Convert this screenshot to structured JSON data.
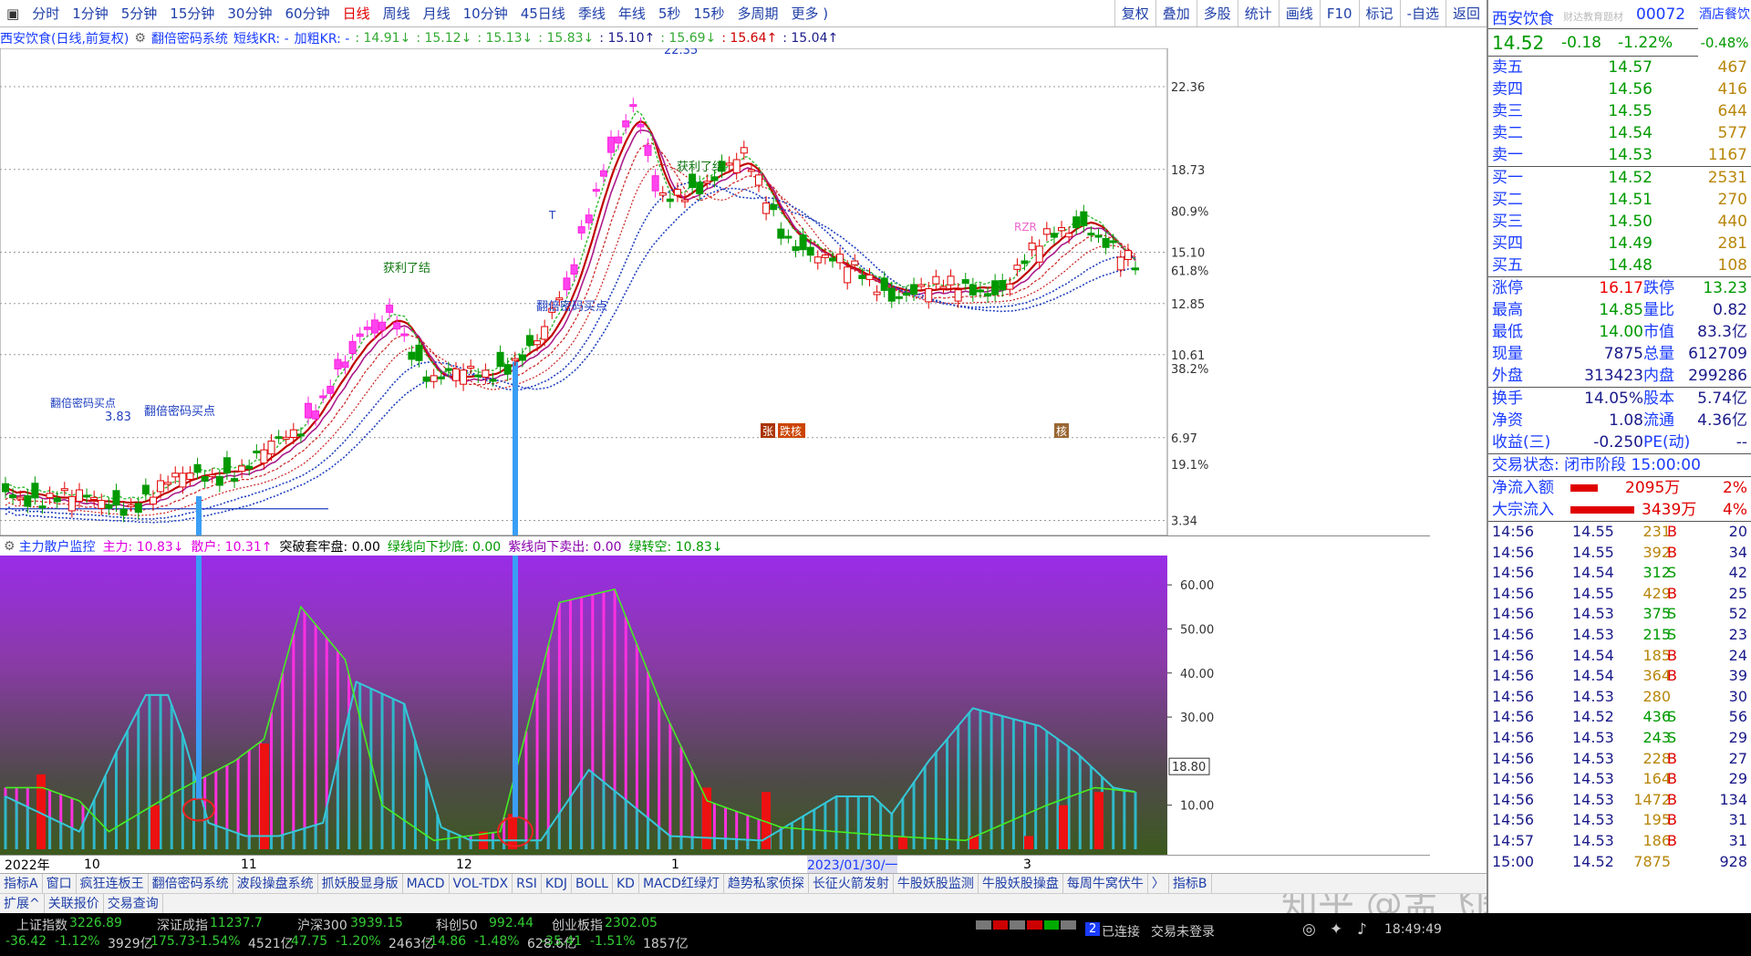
{
  "toolbar": {
    "periods": [
      "分时",
      "1分钟",
      "5分钟",
      "15分钟",
      "30分钟",
      "60分钟",
      "日线",
      "周线",
      "月线",
      "10分钟",
      "45日线",
      "季线",
      "年线",
      "5秒",
      "15秒",
      "多周期",
      "更多 )"
    ],
    "active_index": 6,
    "right": [
      "复权",
      "叠加",
      "多股",
      "统计",
      "画线",
      "F10",
      "标记",
      "-自选",
      "返回"
    ]
  },
  "chart_title": {
    "stock": "西安饮食(日线,前复权)",
    "system": "翻倍密码系统",
    "kr_label": "短线KR: -",
    "jc_label": "加粗KR: -",
    "values": [
      ": 14.91↓",
      ": 15.12↓",
      ": 15.13↓",
      ": 15.83↓",
      ": 15.10↑",
      ": 15.69↓",
      ": 15.64↑",
      ": 15.04↑"
    ]
  },
  "price_axis": {
    "labels": [
      "22.36",
      "18.73",
      "15.10",
      "12.85",
      "10.61",
      "6.97",
      "3.34"
    ],
    "pct": [
      "80.9%",
      "61.8%",
      "38.2%",
      "19.1%"
    ]
  },
  "annotations": {
    "peak": "22.35",
    "low": "3.83",
    "profit1": "获利了结",
    "profit2": "获利了结",
    "buy1": "翻倍密码买点",
    "buy2": "翻倍密码买点",
    "buy3": "翻倍密码买点",
    "rzr": "RZR",
    "t": "T",
    "zhang": "张",
    "dietan": "跌核",
    "tan": "核"
  },
  "sub_title": {
    "name": "主力散户监控",
    "items": [
      "主力: 10.83↓",
      "散户: 10.31↑",
      "突破套牢盘: 0.00",
      "绿线向下抄底: 0.00",
      "紫线向下卖出: 0.00",
      "绿转空: 10.83↓"
    ]
  },
  "sub_axis": {
    "labels": [
      "60.00",
      "50.00",
      "40.00",
      "30.00",
      "10.00"
    ],
    "current": "18.80"
  },
  "time_axis": {
    "labels": [
      "2022年",
      "10",
      "11",
      "12",
      "1",
      "2023/01/30/一",
      "3"
    ]
  },
  "indicator_tabs": [
    "指标A",
    "窗口",
    "疯狂连板王",
    "翻倍密码系统",
    "波段操盘系统",
    "抓妖股显身版",
    "MACD",
    "VOL-TDX",
    "RSI",
    "KDJ",
    "BOLL",
    "KD",
    "MACD红绿灯",
    "趋势私家侦探",
    "长征火箭发射",
    "牛股妖股监测",
    "牛股妖股操盘",
    "每周牛窝伏牛",
    "〉",
    "指标B"
  ],
  "ext_tabs": [
    "扩展^",
    "关联报价",
    "交易查询"
  ],
  "indices": [
    {
      "name": "上证指数",
      "value": "3226.89",
      "chg": "-36.42",
      "pct": "-1.12%",
      "amt": "3929亿"
    },
    {
      "name": "深证成指",
      "value": "11237.7",
      "chg": "-175.73",
      "pct": "-1.54%",
      "amt": "4521亿"
    },
    {
      "name": "沪深300",
      "value": "3939.15",
      "chg": "-47.75",
      "pct": "-1.20%",
      "amt": "2463亿"
    },
    {
      "name": "科创50",
      "value": "992.44",
      "chg": "-14.86",
      "pct": "-1.48%",
      "amt": "628.6亿"
    },
    {
      "name": "创业板指",
      "value": "2302.05",
      "chg": "-35.41",
      "pct": "-1.51%",
      "amt": "1857亿"
    }
  ],
  "status": {
    "conn_count": "2",
    "conn": "已连接",
    "trade": "交易未登录",
    "time": "18:49:49",
    "watermark": "知乎 @孟飞医"
  },
  "quote": {
    "name": "西安饮食",
    "code": "00072",
    "edu": "财达教育题材",
    "sector": "酒店餐饮",
    "price": "14.52",
    "chg": "-0.18",
    "pct": "-1.22%",
    "sector_pct": "-0.48%",
    "sells": [
      {
        "l": "卖五",
        "p": "14.57",
        "v": "467"
      },
      {
        "l": "卖四",
        "p": "14.56",
        "v": "416"
      },
      {
        "l": "卖三",
        "p": "14.55",
        "v": "644"
      },
      {
        "l": "卖二",
        "p": "14.54",
        "v": "577"
      },
      {
        "l": "卖一",
        "p": "14.53",
        "v": "1167"
      }
    ],
    "buys": [
      {
        "l": "买一",
        "p": "14.52",
        "v": "2531"
      },
      {
        "l": "买二",
        "p": "14.51",
        "v": "270"
      },
      {
        "l": "买三",
        "p": "14.50",
        "v": "440"
      },
      {
        "l": "买四",
        "p": "14.49",
        "v": "281"
      },
      {
        "l": "买五",
        "p": "14.48",
        "v": "108"
      }
    ],
    "stats": [
      {
        "a": "涨停",
        "av": "16.17",
        "b": "跌停",
        "bv": "13.23"
      },
      {
        "a": "最高",
        "av": "14.85",
        "b": "量比",
        "bv": "0.82"
      },
      {
        "a": "最低",
        "av": "14.00",
        "b": "市值",
        "bv": "83.3亿"
      },
      {
        "a": "现量",
        "av": "7875",
        "b": "总量",
        "bv": "612709"
      },
      {
        "a": "外盘",
        "av": "313423",
        "b": "内盘",
        "bv": "299286"
      }
    ],
    "stats2": [
      {
        "a": "换手",
        "av": "14.05%",
        "b": "股本",
        "bv": "5.74亿"
      },
      {
        "a": "净资",
        "av": "1.08",
        "b": "流通",
        "bv": "4.36亿"
      },
      {
        "a": "收益(三)",
        "av": "-0.250",
        "b": "PE(动)",
        "bv": "--"
      }
    ],
    "trade_state": "交易状态: 闭市阶段 15:00:00",
    "netin": {
      "label": "净流入额",
      "v": "2095万",
      "pct": "2%"
    },
    "bigin": {
      "label": "大宗流入",
      "v": "3439万",
      "pct": "4%"
    },
    "ticks": [
      [
        "14:56",
        "14.55",
        "231",
        "B",
        "20"
      ],
      [
        "14:56",
        "14.55",
        "392",
        "B",
        "34"
      ],
      [
        "14:56",
        "14.54",
        "312",
        "S",
        "42"
      ],
      [
        "14:56",
        "14.55",
        "429",
        "B",
        "25"
      ],
      [
        "14:56",
        "14.53",
        "375",
        "S",
        "52"
      ],
      [
        "14:56",
        "14.53",
        "215",
        "S",
        "23"
      ],
      [
        "14:56",
        "14.54",
        "185",
        "B",
        "24"
      ],
      [
        "14:56",
        "14.54",
        "364",
        "B",
        "39"
      ],
      [
        "14:56",
        "14.53",
        "280",
        "",
        "30"
      ],
      [
        "14:56",
        "14.52",
        "436",
        "S",
        "56"
      ],
      [
        "14:56",
        "14.53",
        "243",
        "S",
        "29"
      ],
      [
        "14:56",
        "14.53",
        "228",
        "B",
        "27"
      ],
      [
        "14:56",
        "14.53",
        "164",
        "B",
        "29"
      ],
      [
        "14:56",
        "14.53",
        "1472",
        "B",
        "134"
      ],
      [
        "14:56",
        "14.53",
        "195",
        "B",
        "31"
      ],
      [
        "14:57",
        "14.53",
        "186",
        "B",
        "31"
      ],
      [
        "15:00",
        "14.52",
        "7875",
        "",
        "928"
      ]
    ]
  }
}
